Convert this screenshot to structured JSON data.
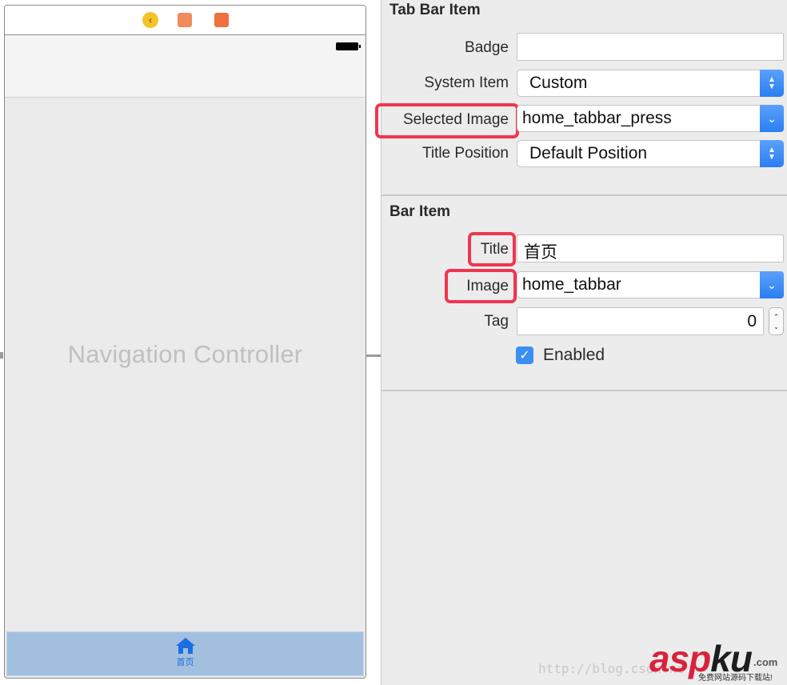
{
  "scene": {
    "title": "Navigation Controller",
    "dock_icons": [
      "back-icon",
      "cube-icon",
      "exit-icon"
    ],
    "tab_bar": {
      "item_label": "首页",
      "item_icon": "home-icon",
      "color": "#a3bfe0"
    }
  },
  "inspector": {
    "tab_bar_item": {
      "heading": "Tab Bar Item",
      "badge": {
        "label": "Badge",
        "value": ""
      },
      "system_item": {
        "label": "System Item",
        "value": "Custom"
      },
      "selected_image": {
        "label": "Selected Image",
        "value": "home_tabbar_press"
      },
      "title_position": {
        "label": "Title Position",
        "value": "Default Position"
      }
    },
    "bar_item": {
      "heading": "Bar Item",
      "title": {
        "label": "Title",
        "value": "首页"
      },
      "image": {
        "label": "Image",
        "value": "home_tabbar"
      },
      "tag": {
        "label": "Tag",
        "value": "0"
      },
      "enabled": {
        "label": "Enabled",
        "checked": true
      }
    }
  },
  "highlight_color": "#f0364f",
  "accent_color": "#3b8ff3",
  "watermark": {
    "url": "http://blog.csdn.ne",
    "logo_a": "asp",
    "logo_b": "ku",
    "logo_c": ".com",
    "tagline": "免费网站源码下载站!"
  }
}
